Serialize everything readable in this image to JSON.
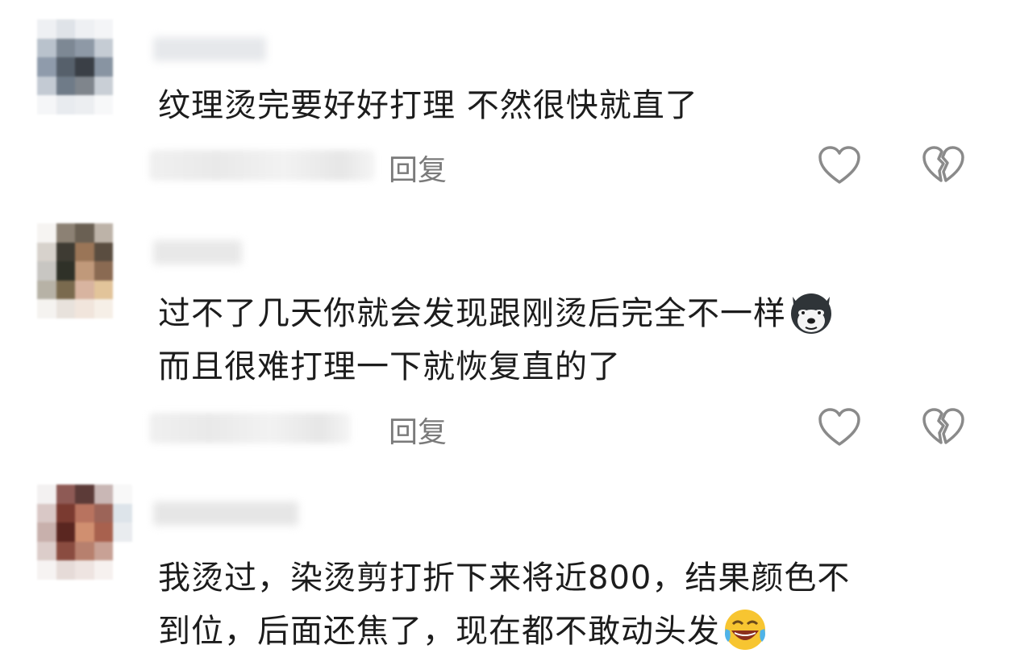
{
  "comments": [
    {
      "lines": [
        "纹理烫完要好好打理 不然很快就直了"
      ],
      "reply_label": "回复",
      "emoji": null
    },
    {
      "lines": [
        "过不了几天你就会发现跟刚烫后完全不一样",
        "而且很难打理一下就恢复直的了"
      ],
      "reply_label": "回复",
      "emoji": "husky-face"
    },
    {
      "lines": [
        "我烫过，染烫剪打折下来将近800，结果颜色不",
        "到位，后面还焦了，现在都不敢动头发"
      ],
      "reply_label": "",
      "emoji": "rolling-laughing-face"
    }
  ],
  "icons": {
    "like": "heart-outline-icon",
    "dislike": "broken-heart-icon"
  },
  "colors": {
    "text": "#1c1c1c",
    "meta": "#7a7a7a",
    "icon": "#8a8a8a"
  }
}
